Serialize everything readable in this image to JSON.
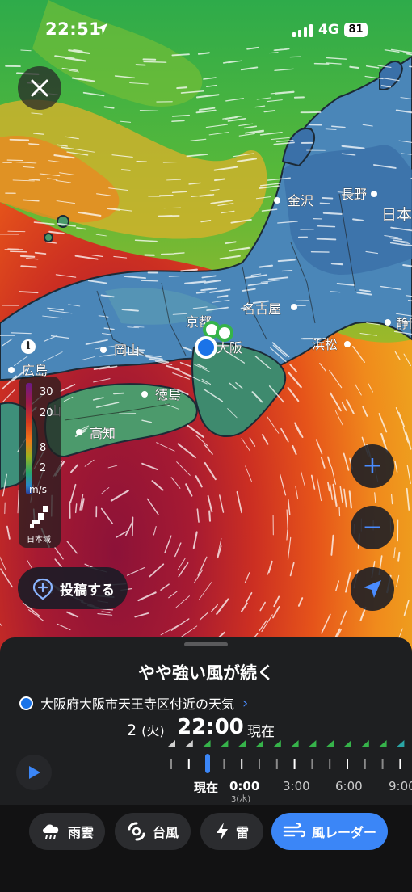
{
  "status_bar": {
    "time": "22:51",
    "network": "4G",
    "battery": "81"
  },
  "map": {
    "cities": [
      {
        "name": "金沢"
      },
      {
        "name": "長野"
      },
      {
        "name": "日本"
      },
      {
        "name": "名古屋"
      },
      {
        "name": "京都"
      },
      {
        "name": "大阪"
      },
      {
        "name": "浜松"
      },
      {
        "name": "静岡"
      },
      {
        "name": "岡山"
      },
      {
        "name": "広島"
      },
      {
        "name": "徳島"
      },
      {
        "name": "高知"
      },
      {
        "name": "山"
      }
    ]
  },
  "legend": {
    "ticks": [
      "30",
      "20",
      "8",
      "2"
    ],
    "unit": "m/s",
    "region": "日本域",
    "region_icon": "japan-map-icon"
  },
  "controls": {
    "zoom_in": "+",
    "zoom_out": "−",
    "locate_icon": "navigation-arrow-icon"
  },
  "post_button": {
    "label": "投稿する",
    "icon": "post-pin-icon"
  },
  "sheet": {
    "headline": "やや強い風が続く",
    "location": "大阪府大阪市天王寺区付近の天気",
    "date_day": "2",
    "date_weekday": "(火)",
    "date_time": "22:00",
    "date_now": "現在"
  },
  "timeline": {
    "now_label": "現在",
    "ticks": [
      {
        "label": "0:00",
        "sub": "3(水)"
      },
      {
        "label": "3:00",
        "sub": ""
      },
      {
        "label": "6:00",
        "sub": ""
      },
      {
        "label": "9:00",
        "sub": ""
      }
    ],
    "flag_colors": [
      "#d0d0d0",
      "#d0d0d0",
      "#36b34a",
      "#36b34a",
      "#36b34a",
      "#36b34a",
      "#36b34a",
      "#36b34a",
      "#36b34a",
      "#36b34a",
      "#36b34a",
      "#36b34a",
      "#36b34a",
      "#2aa6a6",
      "#2aa6a6"
    ]
  },
  "tabs": [
    {
      "label": "雨雲",
      "icon": "rain-cloud-icon"
    },
    {
      "label": "台風",
      "icon": "typhoon-icon"
    },
    {
      "label": "雷",
      "icon": "lightning-icon"
    },
    {
      "label": "風レーダー",
      "icon": "wind-icon",
      "active": true
    }
  ],
  "colors": {
    "accent": "#3b86f7",
    "sheet_bg": "#1e1f21"
  }
}
